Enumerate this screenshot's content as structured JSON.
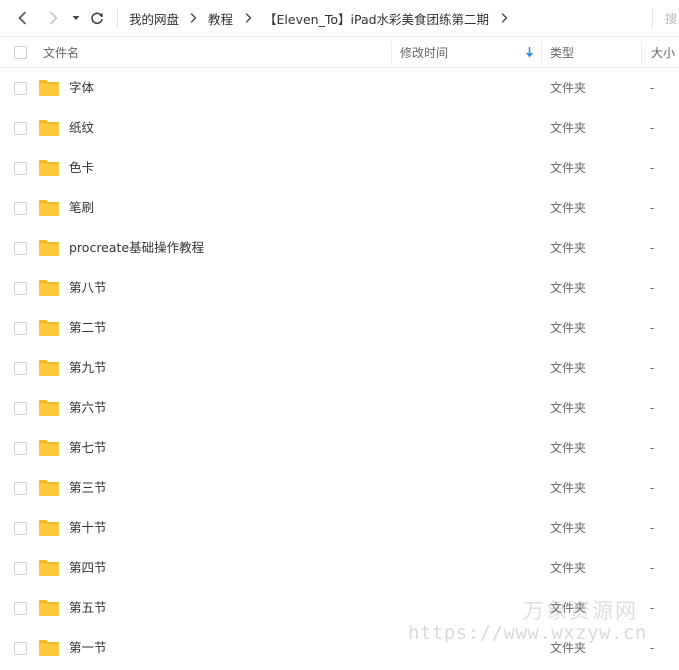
{
  "nav": {
    "crumbs": [
      "我的网盘",
      "教程",
      "【Eleven_To】iPad水彩美食团练第二期"
    ],
    "search_placeholder": "搜"
  },
  "header": {
    "name": "文件名",
    "modified": "修改时间",
    "type": "类型",
    "size": "大小"
  },
  "files": [
    {
      "name": "字体",
      "type": "文件夹",
      "size": "-"
    },
    {
      "name": "纸纹",
      "type": "文件夹",
      "size": "-"
    },
    {
      "name": "色卡",
      "type": "文件夹",
      "size": "-"
    },
    {
      "name": "笔刷",
      "type": "文件夹",
      "size": "-"
    },
    {
      "name": "procreate基础操作教程",
      "type": "文件夹",
      "size": "-"
    },
    {
      "name": "第八节",
      "type": "文件夹",
      "size": "-"
    },
    {
      "name": "第二节",
      "type": "文件夹",
      "size": "-"
    },
    {
      "name": "第九节",
      "type": "文件夹",
      "size": "-"
    },
    {
      "name": "第六节",
      "type": "文件夹",
      "size": "-"
    },
    {
      "name": "第七节",
      "type": "文件夹",
      "size": "-"
    },
    {
      "name": "第三节",
      "type": "文件夹",
      "size": "-"
    },
    {
      "name": "第十节",
      "type": "文件夹",
      "size": "-"
    },
    {
      "name": "第四节",
      "type": "文件夹",
      "size": "-"
    },
    {
      "name": "第五节",
      "type": "文件夹",
      "size": "-"
    },
    {
      "name": "第一节",
      "type": "文件夹",
      "size": "-"
    }
  ],
  "watermark": {
    "title": "万象资源网",
    "url": "https://www.wxzyw.cn"
  },
  "colors": {
    "folder": "#FFC83D",
    "folder_tab": "#F5B623",
    "sort_arrow": "#2A8BF2",
    "text": "#333333"
  },
  "icons": {
    "back": "chevron-left-icon",
    "forward": "chevron-right-icon",
    "dropdown": "caret-down-icon",
    "refresh": "refresh-icon",
    "sort": "arrow-down-icon",
    "folder": "folder-icon"
  }
}
